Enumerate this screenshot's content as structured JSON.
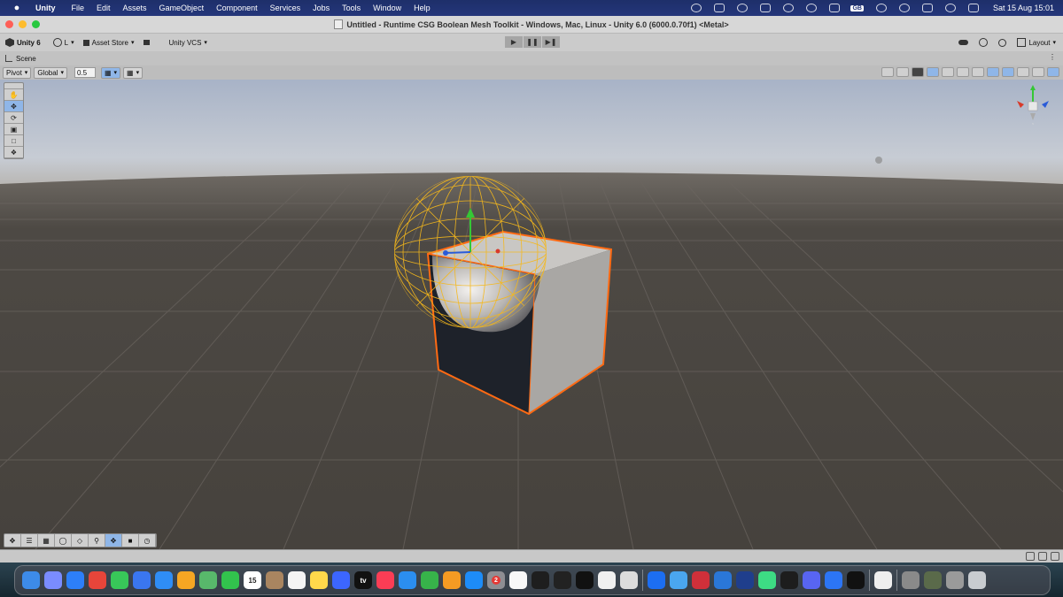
{
  "menubar": {
    "app_name": "Unity",
    "items": [
      "File",
      "Edit",
      "Assets",
      "GameObject",
      "Component",
      "Services",
      "Jobs",
      "Tools",
      "Window",
      "Help"
    ],
    "input_source": "GB",
    "clock": "Sat 15 Aug  15:01"
  },
  "window": {
    "title": "Untitled - Runtime CSG Boolean Mesh Toolkit - Windows, Mac, Linux - Unity 6.0 (6000.0.70f1) <Metal>"
  },
  "toolbar": {
    "unity_label": "Unity 6",
    "account_label": "L",
    "asset_store_label": "Asset Store",
    "vcs_label": "Unity VCS",
    "layout_label": "Layout"
  },
  "scene_tab": {
    "label": "Scene"
  },
  "scene_toolbar": {
    "pivot_label": "Pivot",
    "global_label": "Global",
    "snap_value": "0.5"
  },
  "scene": {
    "cube_outline_color": "#ff6a13",
    "sphere_wire_color": "#f5b81c",
    "grid_color": "#6b6560",
    "ground_color": "#4a4642",
    "sky_color": "#aab4c8"
  },
  "dock": {
    "calendar_day": "15",
    "appletv_label": "tv",
    "badge_count": "2",
    "apps": [
      {
        "name": "finder-icon",
        "color": "#3d8be8"
      },
      {
        "name": "launchpad-icon",
        "color": "#7a8cff"
      },
      {
        "name": "safari-icon",
        "color": "#2d7ff9"
      },
      {
        "name": "chrome-icon",
        "color": "#e7453a"
      },
      {
        "name": "messages-icon",
        "color": "#38c759"
      },
      {
        "name": "signal-icon",
        "color": "#3a76f0"
      },
      {
        "name": "mail-icon",
        "color": "#2f8df5"
      },
      {
        "name": "photos-icon",
        "color": "#f6a623"
      },
      {
        "name": "maps-icon",
        "color": "#58b86b"
      },
      {
        "name": "facetime-icon",
        "color": "#32c24d"
      },
      {
        "name": "calendar-icon",
        "color": "#ffffff"
      },
      {
        "name": "contacts-icon",
        "color": "#a98560"
      },
      {
        "name": "reminders-icon",
        "color": "#f4f4f4"
      },
      {
        "name": "notes-icon",
        "color": "#ffd84b"
      },
      {
        "name": "freeform-icon",
        "color": "#3c66ff"
      },
      {
        "name": "appletv-icon",
        "color": "#111111"
      },
      {
        "name": "music-icon",
        "color": "#fa3d55"
      },
      {
        "name": "keynote-icon",
        "color": "#2b8ef0"
      },
      {
        "name": "numbers-icon",
        "color": "#37b34a"
      },
      {
        "name": "pages-icon",
        "color": "#f59b23"
      },
      {
        "name": "appstore-icon",
        "color": "#1d8cf8"
      },
      {
        "name": "settings-icon",
        "color": "#8e8e93"
      },
      {
        "name": "news-icon",
        "color": "#f8f8f8"
      },
      {
        "name": "terminal-icon",
        "color": "#1e1e1e"
      },
      {
        "name": "unity-hub-icon",
        "color": "#222222"
      },
      {
        "name": "chatgpt-icon",
        "color": "#111111"
      },
      {
        "name": "testflight-icon",
        "color": "#f0f0f0"
      },
      {
        "name": "xcode-helper-icon",
        "color": "#dcdcdc"
      },
      {
        "name": "xcode-icon",
        "color": "#1c6ef2"
      },
      {
        "name": "files-icon",
        "color": "#4aa6f0"
      },
      {
        "name": "preview-icon",
        "color": "#d0303a"
      },
      {
        "name": "cloud-icon",
        "color": "#2a77d8"
      },
      {
        "name": "quicktime-icon",
        "color": "#1f3e8c"
      },
      {
        "name": "android-studio-icon",
        "color": "#3ddc84"
      },
      {
        "name": "wifi-tool-icon",
        "color": "#1d1d1d"
      },
      {
        "name": "discord-icon",
        "color": "#5865f2"
      },
      {
        "name": "vpn-icon",
        "color": "#2c75f5"
      },
      {
        "name": "unity-icon",
        "color": "#111111"
      },
      {
        "name": "document-icon",
        "color": "#eeeeee"
      },
      {
        "name": "thumbnail-1-icon",
        "color": "#8a8a8a"
      },
      {
        "name": "thumbnail-2-icon",
        "color": "#5a6a4a"
      },
      {
        "name": "thumbnail-3-icon",
        "color": "#9a9a9a"
      },
      {
        "name": "trash-icon",
        "color": "#c8ccd0"
      }
    ]
  }
}
